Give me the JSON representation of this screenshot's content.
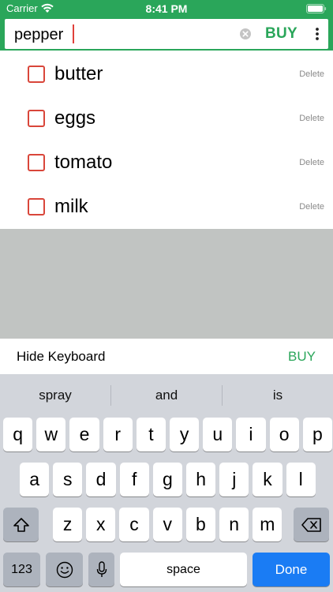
{
  "status_bar": {
    "carrier": "Carrier",
    "time": "8:41 PM"
  },
  "header": {
    "search_value": "pepper",
    "buy_label": "BUY"
  },
  "list": {
    "items": [
      {
        "label": "butter",
        "delete": "Delete"
      },
      {
        "label": "eggs",
        "delete": "Delete"
      },
      {
        "label": "tomato",
        "delete": "Delete"
      },
      {
        "label": "milk",
        "delete": "Delete"
      }
    ]
  },
  "toolbar": {
    "hide_keyboard": "Hide Keyboard",
    "buy_label": "BUY"
  },
  "keyboard": {
    "suggestions": [
      "spray",
      "and",
      "is"
    ],
    "row1": [
      "q",
      "w",
      "e",
      "r",
      "t",
      "y",
      "u",
      "i",
      "o",
      "p"
    ],
    "row2": [
      "a",
      "s",
      "d",
      "f",
      "g",
      "h",
      "j",
      "k",
      "l"
    ],
    "row3": [
      "z",
      "x",
      "c",
      "v",
      "b",
      "n",
      "m"
    ],
    "numbers_key": "123",
    "space_key": "space",
    "done_key": "Done"
  },
  "colors": {
    "brand_green": "#2aa65a",
    "checkbox_red": "#d9463a",
    "done_blue": "#1a7cf4"
  }
}
